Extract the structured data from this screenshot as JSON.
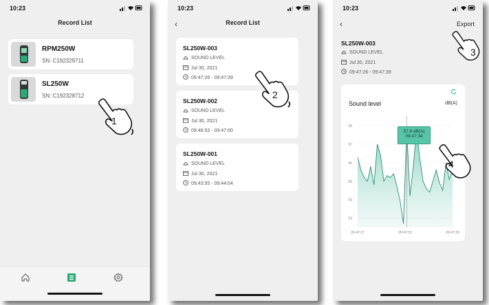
{
  "status": {
    "time": "10:23"
  },
  "screen1": {
    "title": "Record List",
    "devices": [
      {
        "name": "RPM250W",
        "sn": "SN: C192329711"
      },
      {
        "name": "SL250W",
        "sn": "SN: C192328712"
      }
    ],
    "step": "1"
  },
  "screen2": {
    "title": "Record List",
    "records": [
      {
        "name": "SL250W-003",
        "type": "SOUND LEVEL",
        "date": "Jul 30, 2021",
        "time": "09:47:26 - 09:47:39"
      },
      {
        "name": "SL250W-002",
        "type": "SOUND LEVEL",
        "date": "Jul 30, 2021",
        "time": "09:46:53 - 09:47:00"
      },
      {
        "name": "SL250W-001",
        "type": "SOUND LEVEL",
        "date": "Jul 30, 2021",
        "time": "09:43:55 - 09:44:04"
      }
    ],
    "step": "2"
  },
  "screen3": {
    "export_label": "Export",
    "record": {
      "name": "SL250W-003",
      "type": "SOUND LEVEL",
      "date": "Jul 30, 2021",
      "time": "09:47:26 - 09:47:39"
    },
    "step_export": "3",
    "step_chart": "4",
    "tooltip": {
      "value": "57.8 dB(A)",
      "time": "09:47:34"
    }
  },
  "colors": {
    "accent": "#2aa878",
    "chart_fill": "#cdebe3",
    "chart_line": "#2a8c78"
  },
  "icons": {
    "home": "home-icon",
    "list": "list-icon",
    "settings": "gear-icon"
  },
  "chart_data": {
    "type": "area",
    "title": "Sound level",
    "unit": "dB(A)",
    "ylim": [
      52.5,
      58.3
    ],
    "yticks": [
      "58",
      "57",
      "56",
      "55",
      "54",
      "53"
    ],
    "yticks_values": [
      58,
      57,
      56,
      55,
      54,
      53
    ],
    "xticks": [
      "09:47:27",
      "09:47:33",
      "09:47:39"
    ],
    "grid": true,
    "series": [
      {
        "values": [
          56.3,
          55.6,
          55.2,
          55.0,
          55.8,
          54.8,
          57.0,
          56.4,
          55.0,
          55.3,
          55.2,
          55.4,
          54.7,
          53.9,
          52.7,
          57.8,
          54.2,
          55.8,
          57.8,
          56.2,
          55.0,
          54.6,
          54.4,
          55.0,
          55.6,
          54.9,
          54.5,
          56.0,
          55.1,
          55.6
        ]
      }
    ],
    "highlight": {
      "value": 57.8,
      "time": "09:47:34"
    }
  }
}
